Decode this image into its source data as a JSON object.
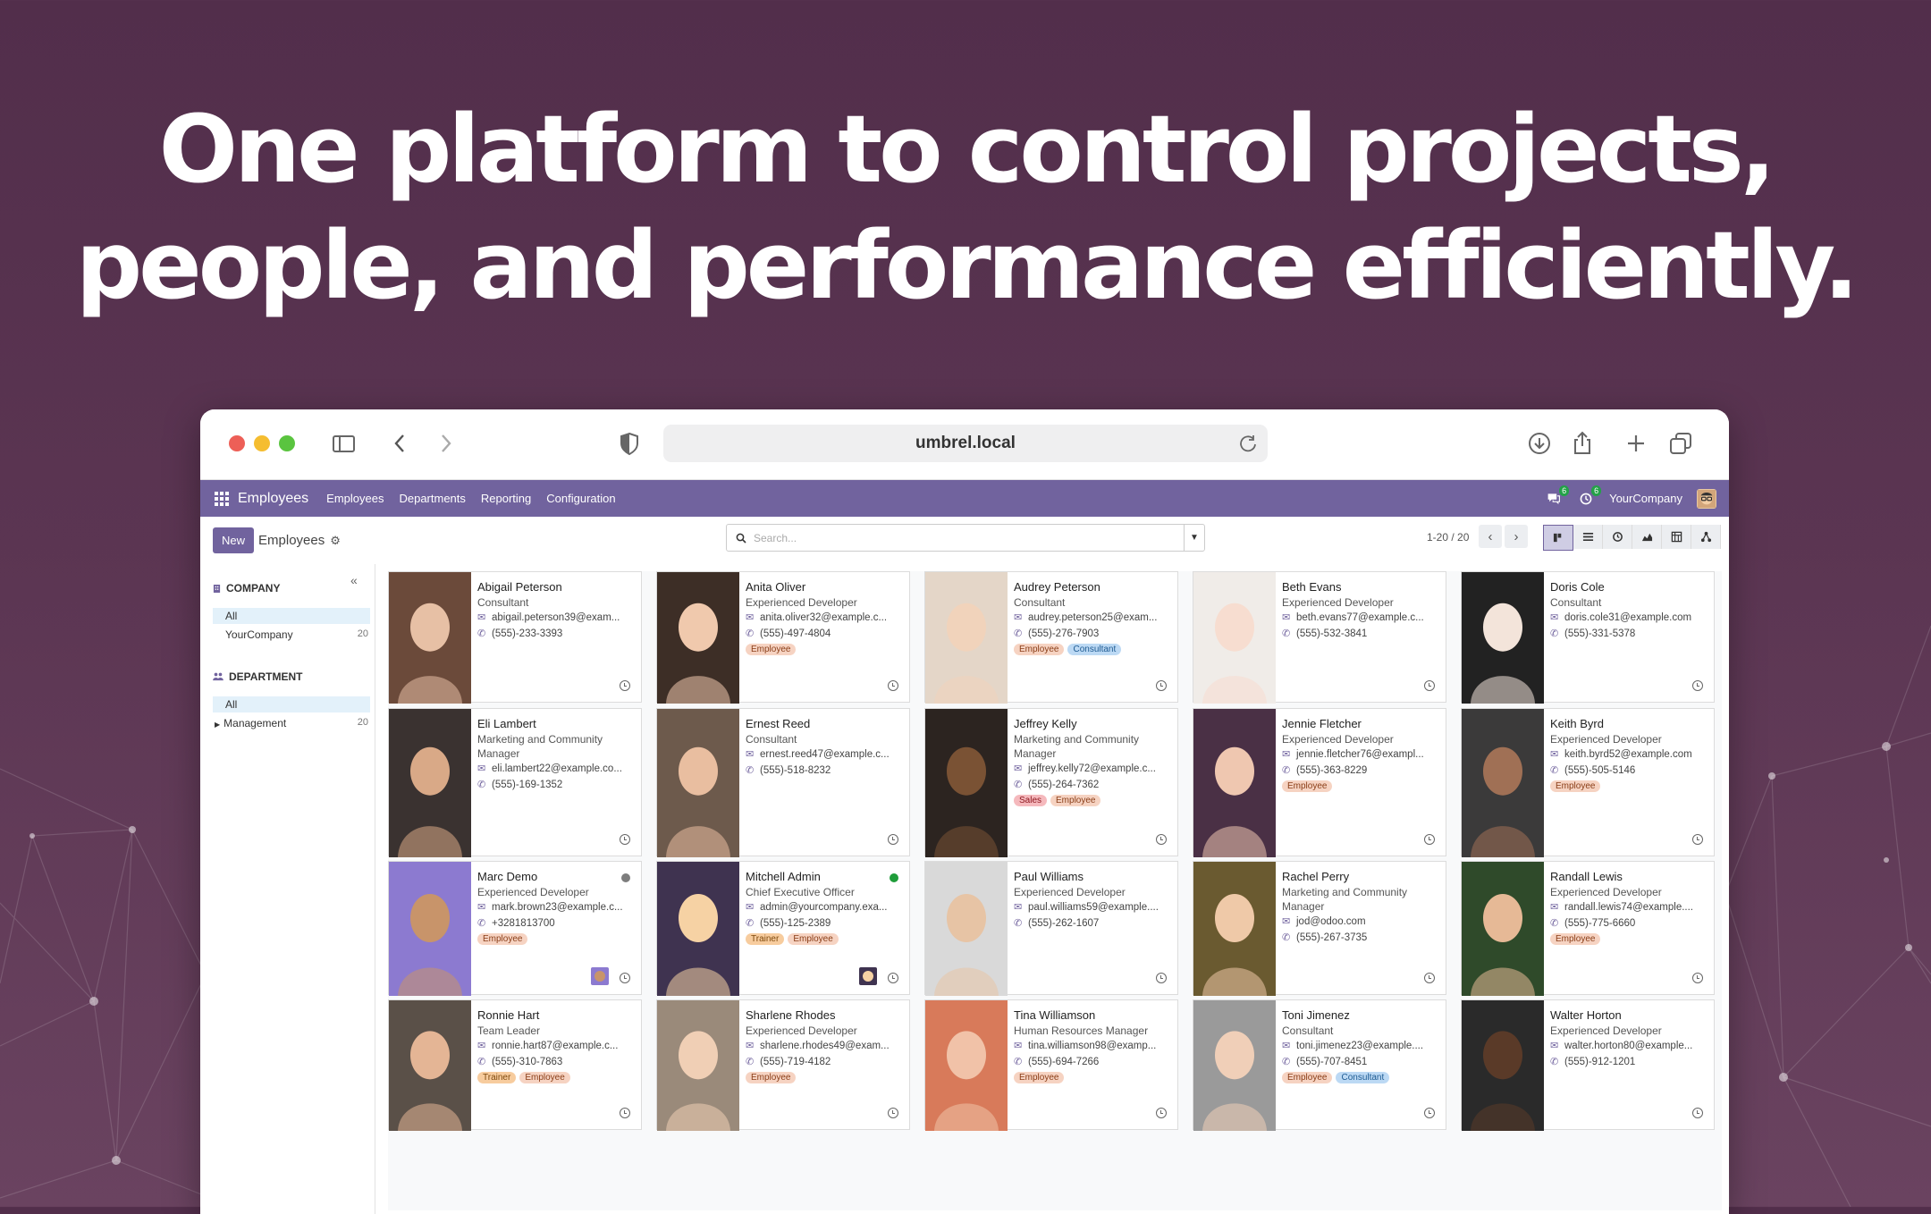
{
  "headline": {
    "line1": "One platform to control projects,",
    "line2": "people, and performance efficiently."
  },
  "browser": {
    "url": "umbrel.local"
  },
  "topnav": {
    "brand": "Employees",
    "menu": [
      "Employees",
      "Departments",
      "Reporting",
      "Configuration"
    ],
    "messages_count": "6",
    "activities_count": "6",
    "company": "YourCompany"
  },
  "control": {
    "new_label": "New",
    "breadcrumb": "Employees",
    "search_placeholder": "Search...",
    "pager": "1-20 / 20"
  },
  "sidebar": {
    "company_title": "COMPANY",
    "company_all": "All",
    "company_item": "YourCompany",
    "company_count": "20",
    "department_title": "DEPARTMENT",
    "department_all": "All",
    "department_item": "Management",
    "department_count": "20"
  },
  "employees": [
    {
      "name": "Abigail Peterson",
      "job": "Consultant",
      "email": "abigail.peterson39@exam...",
      "phone": "(555)-233-3393",
      "tags": []
    },
    {
      "name": "Anita Oliver",
      "job": "Experienced Developer",
      "email": "anita.oliver32@example.c...",
      "phone": "(555)-497-4804",
      "tags": [
        "Employee"
      ]
    },
    {
      "name": "Audrey Peterson",
      "job": "Consultant",
      "email": "audrey.peterson25@exam...",
      "phone": "(555)-276-7903",
      "tags": [
        "Employee",
        "Consultant"
      ]
    },
    {
      "name": "Beth Evans",
      "job": "Experienced Developer",
      "email": "beth.evans77@example.c...",
      "phone": "(555)-532-3841",
      "tags": []
    },
    {
      "name": "Doris Cole",
      "job": "Consultant",
      "email": "doris.cole31@example.com",
      "phone": "(555)-331-5378",
      "tags": []
    },
    {
      "name": "Eli Lambert",
      "job": "Marketing and Community Manager",
      "email": "eli.lambert22@example.co...",
      "phone": "(555)-169-1352",
      "tags": []
    },
    {
      "name": "Ernest Reed",
      "job": "Consultant",
      "email": "ernest.reed47@example.c...",
      "phone": "(555)-518-8232",
      "tags": []
    },
    {
      "name": "Jeffrey Kelly",
      "job": "Marketing and Community Manager",
      "email": "jeffrey.kelly72@example.c...",
      "phone": "(555)-264-7362",
      "tags": [
        "Sales",
        "Employee"
      ]
    },
    {
      "name": "Jennie Fletcher",
      "job": "Experienced Developer",
      "email": "jennie.fletcher76@exampl...",
      "phone": "(555)-363-8229",
      "tags": [
        "Employee"
      ]
    },
    {
      "name": "Keith Byrd",
      "job": "Experienced Developer",
      "email": "keith.byrd52@example.com",
      "phone": "(555)-505-5146",
      "tags": [
        "Employee"
      ]
    },
    {
      "name": "Marc Demo",
      "job": "Experienced Developer",
      "email": "mark.brown23@example.c...",
      "phone": "+3281813700",
      "tags": [
        "Employee"
      ]
    },
    {
      "name": "Mitchell Admin",
      "job": "Chief Executive Officer",
      "email": "admin@yourcompany.exa...",
      "phone": "(555)-125-2389",
      "tags": [
        "Trainer",
        "Employee"
      ]
    },
    {
      "name": "Paul Williams",
      "job": "Experienced Developer",
      "email": "paul.williams59@example....",
      "phone": "(555)-262-1607",
      "tags": []
    },
    {
      "name": "Rachel Perry",
      "job": "Marketing and Community Manager",
      "email": "jod@odoo.com",
      "phone": "(555)-267-3735",
      "tags": []
    },
    {
      "name": "Randall Lewis",
      "job": "Experienced Developer",
      "email": "randall.lewis74@example....",
      "phone": "(555)-775-6660",
      "tags": [
        "Employee"
      ]
    },
    {
      "name": "Ronnie Hart",
      "job": "Team Leader",
      "email": "ronnie.hart87@example.c...",
      "phone": "(555)-310-7863",
      "tags": [
        "Trainer",
        "Employee"
      ]
    },
    {
      "name": "Sharlene Rhodes",
      "job": "Experienced Developer",
      "email": "sharlene.rhodes49@exam...",
      "phone": "(555)-719-4182",
      "tags": [
        "Employee"
      ]
    },
    {
      "name": "Tina Williamson",
      "job": "Human Resources Manager",
      "email": "tina.williamson98@examp...",
      "phone": "(555)-694-7266",
      "tags": [
        "Employee"
      ]
    },
    {
      "name": "Toni Jimenez",
      "job": "Consultant",
      "email": "toni.jimenez23@example....",
      "phone": "(555)-707-8451",
      "tags": [
        "Employee",
        "Consultant"
      ]
    },
    {
      "name": "Walter Horton",
      "job": "Experienced Developer",
      "email": "walter.horton80@example...",
      "phone": "(555)-912-1201",
      "tags": []
    }
  ],
  "colors": {
    "accent": "#71639e",
    "background": "#5b3552",
    "employee_tag": "#f6d3c2",
    "consultant_tag": "#bcd9f4",
    "sales_tag": "#f5b9bd",
    "trainer_tag": "#f7cc9e",
    "online": "#1f9d3a",
    "away": "#7d7d7d"
  }
}
